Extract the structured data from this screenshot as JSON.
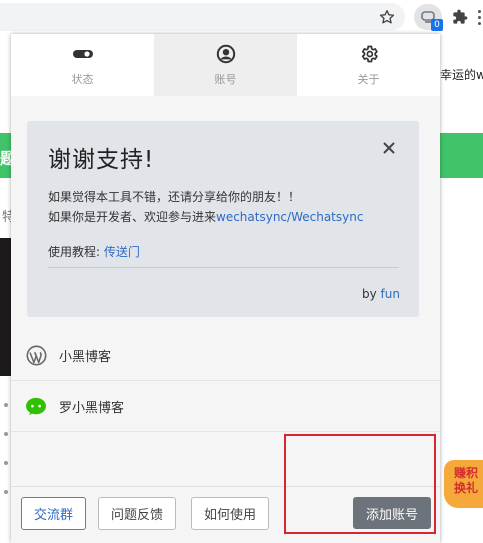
{
  "browser": {
    "extension_badge": "0",
    "background_text_right": "幸运的w",
    "background_green_char": "题",
    "background_char": "特",
    "background_bubble_text": "赚积换礼"
  },
  "popup": {
    "tabs": [
      {
        "label": "状态",
        "icon": "toggle-icon"
      },
      {
        "label": "账号",
        "icon": "account-circle-icon"
      },
      {
        "label": "关于",
        "icon": "gear-icon"
      }
    ],
    "active_tab": 1,
    "card": {
      "title": "谢谢支持!",
      "line1": "如果觉得本工具不错，还请分享给你的朋友！！",
      "line2_text": "如果你是开发者、欢迎参与进来",
      "line2_link": "wechatsync/Wechatsync",
      "tutorial_label": "使用教程:",
      "tutorial_link": "传送门",
      "by_label": "by",
      "by_link": "fun"
    },
    "accounts": [
      {
        "name": "小黑博客",
        "icon": "wordpress-icon"
      },
      {
        "name": "罗小黑博客",
        "icon": "wechat-icon"
      }
    ],
    "footer": {
      "btn_qun": "交流群",
      "btn_feedback": "问题反馈",
      "btn_howto": "如何使用",
      "btn_add": "添加账号"
    }
  },
  "colors": {
    "link": "#2d6bc4",
    "wechat_green": "#2dc100",
    "page_green": "#41c369",
    "highlight_red": "#d8262c",
    "add_button": "#6c737a"
  }
}
